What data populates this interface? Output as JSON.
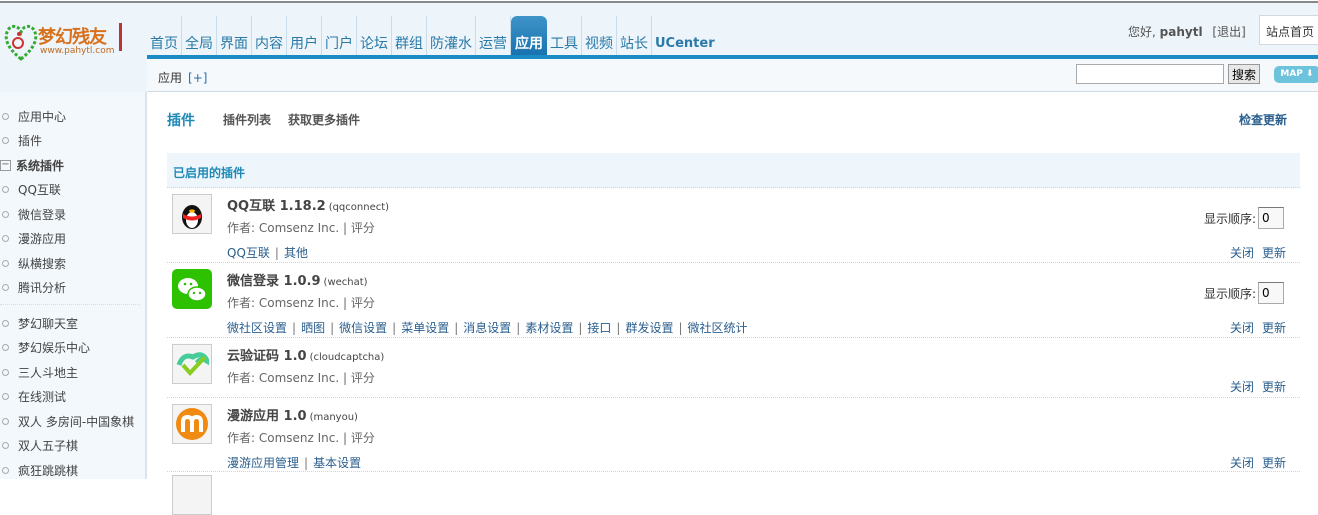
{
  "logo": {
    "name": "梦幻残友",
    "url": "www.pahytl.com"
  },
  "nav": [
    "首页",
    "全局",
    "界面",
    "内容",
    "用户",
    "门户",
    "论坛",
    "群组",
    "防灌水",
    "运营",
    "应用",
    "工具",
    "视频",
    "站长",
    "UCenter"
  ],
  "nav_active": "应用",
  "user": {
    "greeting": "您好,",
    "name": "pahytl",
    "logout": "[退出]",
    "home": "站点首页"
  },
  "subbar": {
    "crumb": "应用",
    "add": "[+]",
    "search_value": "",
    "search_button": "搜索",
    "map": "MAP ⬇"
  },
  "sidebar": {
    "items": [
      "应用中心",
      "插件"
    ],
    "group": "系统插件",
    "group_items": [
      "QQ互联",
      "微信登录",
      "漫游应用",
      "纵横搜索",
      "腾讯分析"
    ],
    "extra_items": [
      "梦幻聊天室",
      "梦幻娱乐中心",
      "三人斗地主",
      "在线测试",
      "双人 多房间-中国象棋",
      "双人五子棋",
      "疯狂跳跳棋"
    ]
  },
  "main": {
    "title": "插件",
    "tabs": [
      "插件列表",
      "获取更多插件"
    ],
    "check_update": "检查更新",
    "section": "已启用的插件",
    "order_label": "显示顺序:",
    "close": "关闭",
    "update": "更新",
    "plugins": [
      {
        "name": "QQ互联 1.18.2",
        "id": "(qqconnect)",
        "author": "作者: Comsenz Inc. | 评分",
        "links": [
          "QQ互联",
          "其他"
        ],
        "order": "0"
      },
      {
        "name": "微信登录 1.0.9",
        "id": "(wechat)",
        "author": "作者: Comsenz Inc. | 评分",
        "links": [
          "微社区设置",
          "晒图",
          "微信设置",
          "菜单设置",
          "消息设置",
          "素材设置",
          "接口",
          "群发设置",
          "微社区统计"
        ],
        "order": "0"
      },
      {
        "name": "云验证码 1.0",
        "id": "(cloudcaptcha)",
        "author": "作者: Comsenz Inc. | 评分",
        "links": []
      },
      {
        "name": "漫游应用 1.0",
        "id": "(manyou)",
        "author": "作者: Comsenz Inc. | 评分",
        "links": [
          "漫游应用管理",
          "基本设置"
        ]
      }
    ]
  }
}
